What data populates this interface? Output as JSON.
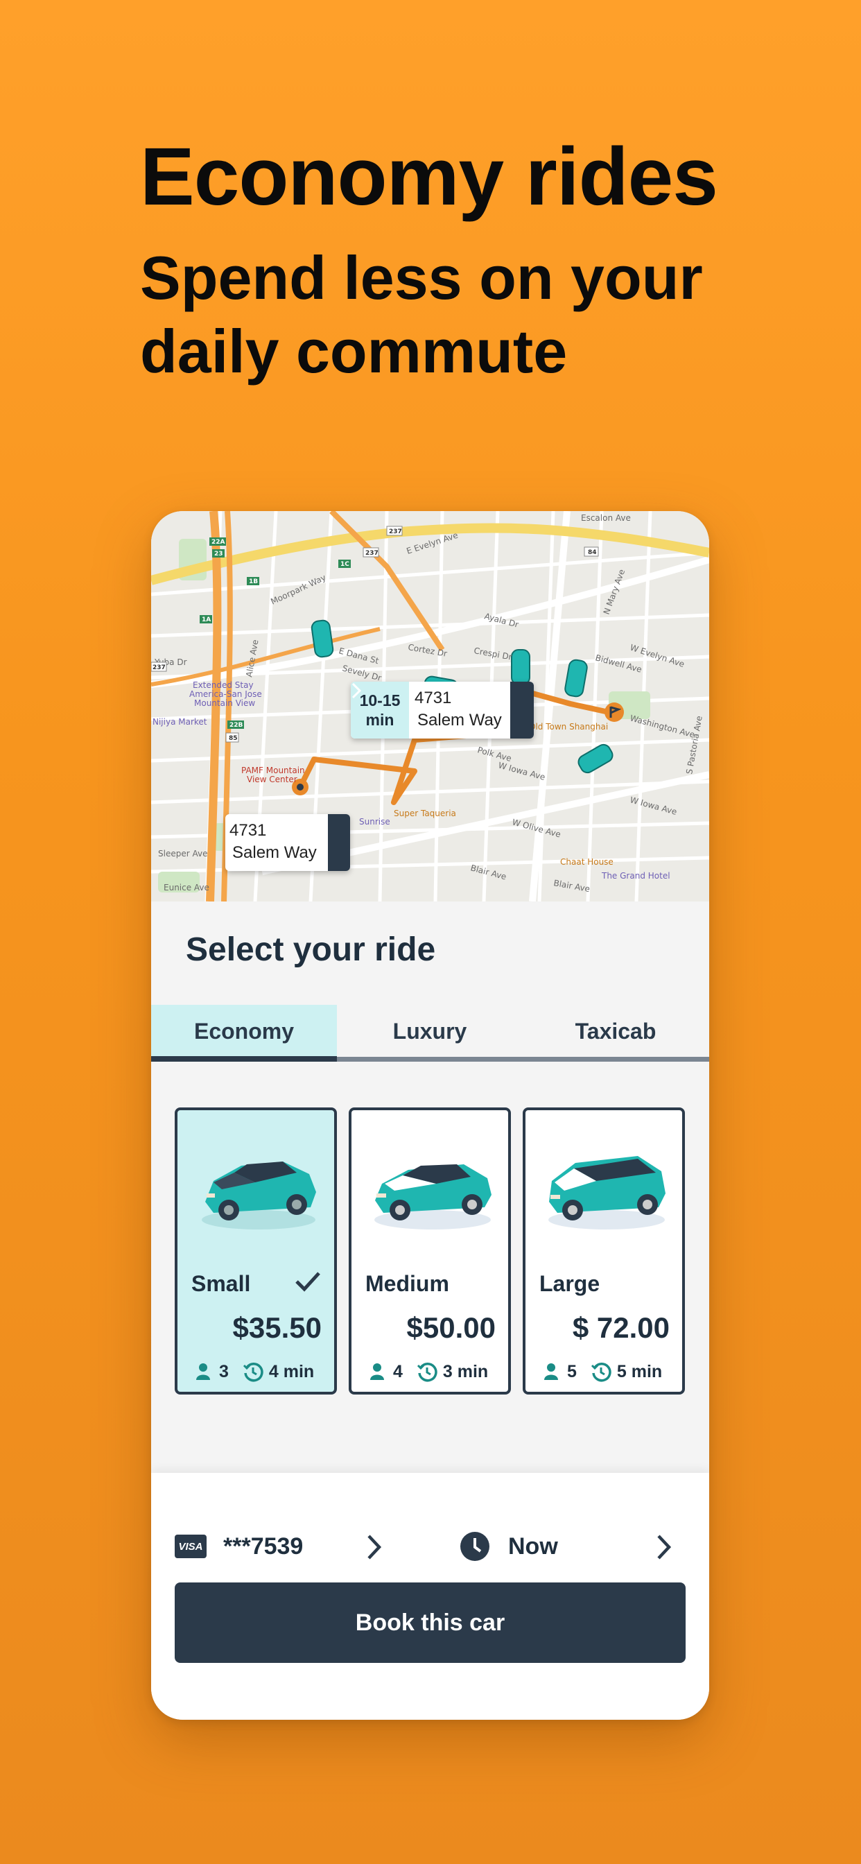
{
  "hero": {
    "title": "Economy rides",
    "subtitle_line1": "Spend less on your",
    "subtitle_line2": "daily commute"
  },
  "map": {
    "destination_eta": {
      "time_line1": "10-15",
      "time_line2": "min",
      "address_line1": "4731",
      "address_line2": "Salem Way"
    },
    "origin": {
      "address_line1": "4731",
      "address_line2": "Salem Way"
    },
    "labels": [
      "Escalon Ave",
      "E Evelyn Ave",
      "W Evelyn Ave",
      "Moorpark Way",
      "Ayala Dr",
      "Cortez Dr",
      "Crespi Dr",
      "E Dana St",
      "Bidwell Ave",
      "Extended Stay America-San Jose Mountain View",
      "Nijiya Market",
      "PAMF Mountain View Center",
      "Polk Ave",
      "W Iowa Ave",
      "Super Taqueria",
      "Sunrise",
      "W Olive Ave",
      "Old Town Shanghai",
      "Chaat House",
      "The Grand Hotel",
      "Blair Ave",
      "Sleeper Ave",
      "Eunice Ave",
      "Washington Ave",
      "S Pastoria Ave",
      "N Mary Ave",
      "Yuba Dr",
      "Alice Ave",
      "Sevely Dr"
    ],
    "road_markers": [
      "237",
      "237",
      "85",
      "1B",
      "1C",
      "23",
      "22A",
      "22B",
      "1A",
      "237",
      "84"
    ]
  },
  "section_title": "Select your ride",
  "tabs": [
    {
      "label": "Economy",
      "active": true
    },
    {
      "label": "Luxury",
      "active": false
    },
    {
      "label": "Taxicab",
      "active": false
    }
  ],
  "rides": [
    {
      "name": "Small",
      "price": "$35.50",
      "seats": "3",
      "eta": "4 min",
      "selected": true
    },
    {
      "name": "Medium",
      "price": "$50.00",
      "seats": "4",
      "eta": "3 min",
      "selected": false
    },
    {
      "name": "Large",
      "price": "$ 72.00",
      "seats": "5",
      "eta": "5 min",
      "selected": false
    }
  ],
  "payment": {
    "brand": "VISA",
    "card_number": "***7539"
  },
  "schedule": {
    "label": "Now"
  },
  "book_button": "Book this car",
  "colors": {
    "background": "#F7951E",
    "accent": "#CDF1F2",
    "dark": "#2B3A4A",
    "car": "#1FB6B0",
    "route": "#E8892A"
  },
  "icons": [
    "visa-icon",
    "chevron-right-icon",
    "clock-icon",
    "person-icon",
    "history-icon",
    "check-icon",
    "car-icon",
    "flag-icon"
  ]
}
